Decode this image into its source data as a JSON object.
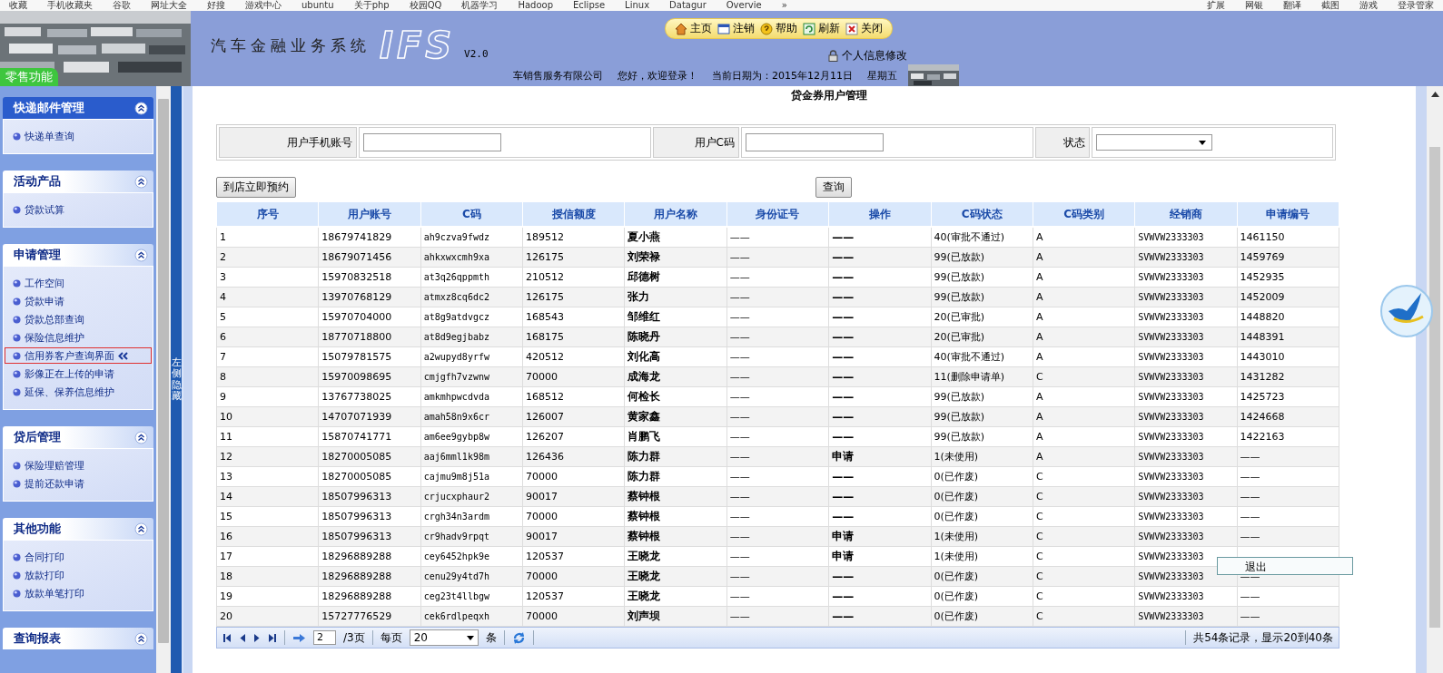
{
  "browser_bar": {
    "bookmarks": [
      "收藏",
      "手机收藏夹",
      "谷歌",
      "网址大全",
      "好搜",
      "游戏中心",
      "ubuntu",
      "关于php",
      "校园QQ",
      "机器学习",
      "Hadoop",
      "Eclipse",
      "Linux",
      "Datagur",
      "Overvie",
      "»"
    ],
    "tools": [
      "扩展",
      "网银",
      "翻译",
      "截图",
      "游戏",
      "登录管家"
    ]
  },
  "header": {
    "title": "汽车金融业务系统",
    "logo": "IFS",
    "version": "V2.0",
    "badge": "零售功能",
    "toolbar": [
      {
        "label": "主页"
      },
      {
        "label": "注销"
      },
      {
        "label": "帮助"
      },
      {
        "label": "刷新"
      },
      {
        "label": "关闭"
      }
    ],
    "profile_link": "个人信息修改",
    "company": "车销售服务有限公司",
    "greeting": "您好，欢迎登录！",
    "date": "当前日期为：2015年12月11日",
    "weekday": "星期五"
  },
  "sidebar": {
    "hide_label": "左侧隐藏",
    "sections": [
      {
        "title": "快递邮件管理",
        "active": true,
        "items": [
          {
            "label": "快递单查询",
            "selected": false
          }
        ]
      },
      {
        "title": "活动产品",
        "active": false,
        "items": [
          {
            "label": "贷款试算",
            "selected": false
          }
        ]
      },
      {
        "title": "申请管理",
        "active": false,
        "items": [
          {
            "label": "工作空间",
            "selected": false
          },
          {
            "label": "贷款申请",
            "selected": false
          },
          {
            "label": "贷款总部查询",
            "selected": false
          },
          {
            "label": "保险信息维护",
            "selected": false
          },
          {
            "label": "信用券客户查询界面",
            "selected": true
          },
          {
            "label": "影像正在上传的申请",
            "selected": false
          },
          {
            "label": "延保、保养信息维护",
            "selected": false
          }
        ]
      },
      {
        "title": "贷后管理",
        "active": false,
        "items": [
          {
            "label": "保险理赔管理",
            "selected": false
          },
          {
            "label": "提前还款申请",
            "selected": false
          }
        ]
      },
      {
        "title": "其他功能",
        "active": false,
        "items": [
          {
            "label": "合同打印",
            "selected": false
          },
          {
            "label": "放款打印",
            "selected": false
          },
          {
            "label": "放款单笔打印",
            "selected": false
          }
        ]
      },
      {
        "title": "查询报表",
        "active": false
      }
    ]
  },
  "page_title": "贷金券用户管理",
  "filters": [
    {
      "label": "用户手机账号",
      "kind": "text"
    },
    {
      "label": "用户C码",
      "kind": "text"
    },
    {
      "label": "状态",
      "kind": "select"
    }
  ],
  "buttons": {
    "reserve": "到店立即预约",
    "query": "查询"
  },
  "table": {
    "columns": [
      "序号",
      "用户账号",
      "C码",
      "授信额度",
      "用户名称",
      "身份证号",
      "操作",
      "C码状态",
      "C码类别",
      "经销商",
      "申请编号"
    ],
    "rows": [
      [
        "1",
        "18679741829",
        "ah9czva9fwdz",
        "189512",
        "夏小燕",
        "——",
        "——",
        "40(审批不通过)",
        "A",
        "SVWVW2333303",
        "1461150"
      ],
      [
        "2",
        "18679071456",
        "ahkxwxcmh9xa",
        "126175",
        "刘荣禄",
        "——",
        "——",
        "99(已放款)",
        "A",
        "SVWVW2333303",
        "1459769"
      ],
      [
        "3",
        "15970832518",
        "at3q26qppmth",
        "210512",
        "邱德树",
        "——",
        "——",
        "99(已放款)",
        "A",
        "SVWVW2333303",
        "1452935"
      ],
      [
        "4",
        "13970768129",
        "atmxz8cq6dc2",
        "126175",
        "张力",
        "——",
        "——",
        "99(已放款)",
        "A",
        "SVWVW2333303",
        "1452009"
      ],
      [
        "5",
        "15970704000",
        "at8g9atdvgcz",
        "168543",
        "邹维红",
        "——",
        "——",
        "20(已审批)",
        "A",
        "SVWVW2333303",
        "1448820"
      ],
      [
        "6",
        "18770718800",
        "at8d9egjbabz",
        "168175",
        "陈晓丹",
        "——",
        "——",
        "20(已审批)",
        "A",
        "SVWVW2333303",
        "1448391"
      ],
      [
        "7",
        "15079781575",
        "a2wupyd8yrfw",
        "420512",
        "刘化高",
        "——",
        "——",
        "40(审批不通过)",
        "A",
        "SVWVW2333303",
        "1443010"
      ],
      [
        "8",
        "15970098695",
        "cmjgfh7vzwnw",
        "70000",
        "成海龙",
        "——",
        "——",
        "11(删除申请单)",
        "C",
        "SVWVW2333303",
        "1431282"
      ],
      [
        "9",
        "13767738025",
        "amkmhpwcdvda",
        "168512",
        "何检长",
        "——",
        "——",
        "99(已放款)",
        "A",
        "SVWVW2333303",
        "1425723"
      ],
      [
        "10",
        "14707071939",
        "amah58n9x6cr",
        "126007",
        "黄家鑫",
        "——",
        "——",
        "99(已放款)",
        "A",
        "SVWVW2333303",
        "1424668"
      ],
      [
        "11",
        "15870741771",
        "am6ee9gybp8w",
        "126207",
        "肖鹏飞",
        "——",
        "——",
        "99(已放款)",
        "A",
        "SVWVW2333303",
        "1422163"
      ],
      [
        "12",
        "18270005085",
        "aaj6mml1k98m",
        "126436",
        "陈力群",
        "——",
        "申请",
        "1(未使用)",
        "A",
        "SVWVW2333303",
        "——"
      ],
      [
        "13",
        "18270005085",
        "cajmu9m8j51a",
        "70000",
        "陈力群",
        "——",
        "——",
        "0(已作废)",
        "C",
        "SVWVW2333303",
        "——"
      ],
      [
        "14",
        "18507996313",
        "crjucxphaur2",
        "90017",
        "蔡钟根",
        "——",
        "——",
        "0(已作废)",
        "C",
        "SVWVW2333303",
        "——"
      ],
      [
        "15",
        "18507996313",
        "crgh34n3ardm",
        "70000",
        "蔡钟根",
        "——",
        "——",
        "0(已作废)",
        "C",
        "SVWVW2333303",
        "——"
      ],
      [
        "16",
        "18507996313",
        "cr9hadv9rpqt",
        "90017",
        "蔡钟根",
        "——",
        "申请",
        "1(未使用)",
        "C",
        "SVWVW2333303",
        "——"
      ],
      [
        "17",
        "18296889288",
        "cey6452hpk9e",
        "120537",
        "王晓龙",
        "——",
        "申请",
        "1(未使用)",
        "C",
        "SVWVW2333303"
      ],
      [
        "18",
        "18296889288",
        "cenu29y4td7h",
        "70000",
        "王晓龙",
        "——",
        "——",
        "0(已作废)",
        "C",
        "SVWVW2333303",
        "——"
      ],
      [
        "19",
        "18296889288",
        "ceg23t4llbgw",
        "120537",
        "王晓龙",
        "——",
        "——",
        "0(已作废)",
        "C",
        "SVWVW2333303",
        "——"
      ],
      [
        "20",
        "15727776529",
        "cek6rdlpeqxh",
        "70000",
        "刘声坝",
        "——",
        "——",
        "0(已作废)",
        "C",
        "SVWVW2333303",
        "——"
      ]
    ]
  },
  "pager": {
    "page": "2",
    "pages": "/3页",
    "per_page_label": "每页",
    "per_page": "20",
    "unit": "条",
    "summary": "共54条记录，显示20到40条"
  },
  "popup": {
    "label": "退出"
  }
}
